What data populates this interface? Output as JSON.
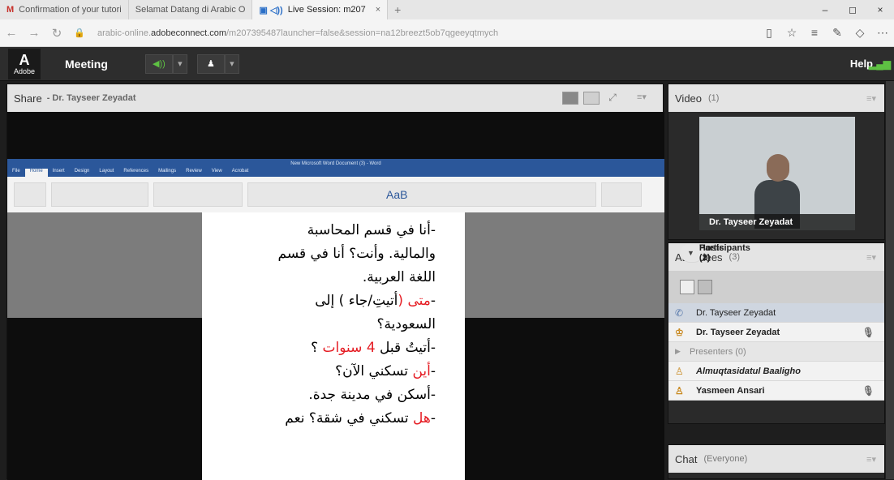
{
  "browser": {
    "tabs": [
      {
        "glyph": "M",
        "label": "Confirmation of your tutori",
        "color": "#c7302a"
      },
      {
        "glyph": "",
        "label": "Selamat Datang di Arabic O"
      },
      {
        "glyph": "▣ ◁))",
        "label": "Live Session: m207",
        "close": "×",
        "active": true
      }
    ],
    "newtab": "+",
    "window_controls": [
      "–",
      "◻",
      "×"
    ],
    "nav": {
      "back": "←",
      "forward": "→",
      "refresh": "↻",
      "lock": "🔒"
    },
    "url_prefix": "arabic-online.",
    "url_domain": "adobeconnect.com",
    "url_suffix": "/m207395487launcher=false&session=na12breezt5ob7qgeeyqtmych",
    "toolbar_icons": [
      "▯",
      "☆",
      "≡",
      "✎",
      "◇",
      "⋯"
    ]
  },
  "connect": {
    "logo_text": "Adobe",
    "logo_glyph": "A",
    "menu_label": "Meeting",
    "speaker_glyph": "◀))",
    "dropdown_glyph": "▾",
    "camera_glyph": "♟",
    "help_label": "Help",
    "signal_glyph": "▂▄▆"
  },
  "share": {
    "title": "Share",
    "presenter": "- Dr. Tayseer Zeyadat",
    "word_title": "New Microsoft Word Document (3) - Word",
    "word_tabs": [
      "File",
      "Home",
      "Insert",
      "Design",
      "Layout",
      "References",
      "Mailings",
      "Review",
      "View",
      "Acrobat"
    ],
    "style_sample": "AaB",
    "lines": [
      {
        "parts": [
          {
            "t": "-أنا في قسم المحاسبة",
            "red": false
          }
        ]
      },
      {
        "parts": [
          {
            "t": "والمالية. وأنت؟ أنا في قسم",
            "red": false
          }
        ]
      },
      {
        "parts": [
          {
            "t": "اللغة العربية.",
            "red": false
          }
        ]
      },
      {
        "parts": [
          {
            "t": "-",
            "red": false
          },
          {
            "t": "متى (",
            "red": true
          },
          {
            "t": "أتيتِ",
            "red": false
          },
          {
            "t": "/",
            "red": false
          },
          {
            "t": "جاء ) إلى",
            "red": false
          }
        ]
      },
      {
        "parts": [
          {
            "t": "السعودية؟",
            "red": false
          }
        ]
      },
      {
        "parts": [
          {
            "t": "-أتيتُ قبل ",
            "red": false
          },
          {
            "t": "4 سنوات",
            "red": true
          },
          {
            "t": " ؟",
            "red": false
          }
        ]
      },
      {
        "parts": [
          {
            "t": "-",
            "red": false
          },
          {
            "t": "أين",
            "red": true
          },
          {
            "t": " تسكني الآن؟",
            "red": false
          }
        ]
      },
      {
        "parts": [
          {
            "t": "-أسكن في مدينة جدة.",
            "red": false
          }
        ]
      },
      {
        "parts": [
          {
            "t": "-",
            "red": false
          },
          {
            "t": "هل",
            "red": true
          },
          {
            "t": " تسكني في شقة؟ نعم",
            "red": false
          }
        ]
      }
    ]
  },
  "video": {
    "title": "Video",
    "count": "(1)",
    "name_label": "Dr. Tayseer Zeyadat"
  },
  "attendees": {
    "title": "Attendees",
    "count": "(3)",
    "selected_row": "Dr. Tayseer Zeyadat",
    "hosts_header": "Hosts (1)",
    "host_name": "Dr. Tayseer Zeyadat",
    "presenters_header": "Presenters (0)",
    "participants_header": "Participants (2)",
    "participants": [
      "Almuqtasidatul Baaligho",
      "Yasmeen Ansari"
    ]
  },
  "chat": {
    "title": "Chat",
    "scope": "(Everyone)"
  },
  "pod_menu_glyph": "≡▾"
}
